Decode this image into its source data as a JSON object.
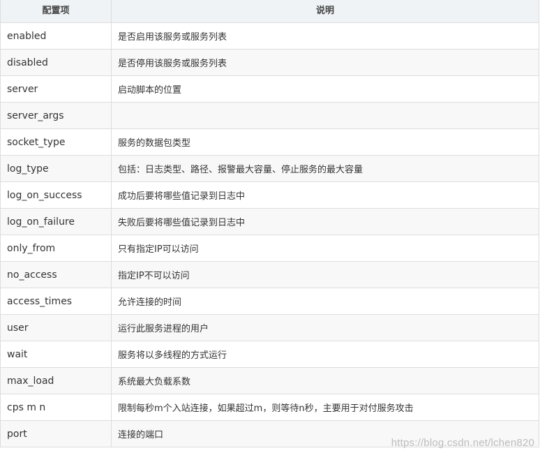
{
  "table": {
    "headers": [
      "配置项",
      "说明"
    ],
    "rows": [
      {
        "key": "enabled",
        "desc": "是否启用该服务或服务列表"
      },
      {
        "key": "disabled",
        "desc": "是否停用该服务或服务列表"
      },
      {
        "key": "server",
        "desc": "启动脚本的位置"
      },
      {
        "key": "server_args",
        "desc": ""
      },
      {
        "key": "socket_type",
        "desc": "服务的数据包类型"
      },
      {
        "key": "log_type",
        "desc": "包括：日志类型、路径、报警最大容量、停止服务的最大容量"
      },
      {
        "key": "log_on_success",
        "desc": "成功后要将哪些值记录到日志中"
      },
      {
        "key": "log_on_failure",
        "desc": "失败后要将哪些值记录到日志中"
      },
      {
        "key": "only_from",
        "desc": "只有指定IP可以访问"
      },
      {
        "key": "no_access",
        "desc": "指定IP不可以访问"
      },
      {
        "key": "access_times",
        "desc": "允许连接的时间"
      },
      {
        "key": "user",
        "desc": "运行此服务进程的用户"
      },
      {
        "key": "wait",
        "desc": "服务将以多线程的方式运行"
      },
      {
        "key": "max_load",
        "desc": "系统最大负载系数"
      },
      {
        "key": "cps m n",
        "desc": "限制每秒m个入站连接，如果超过m，则等待n秒，主要用于对付服务攻击"
      },
      {
        "key": "port",
        "desc": "连接的端口"
      }
    ]
  },
  "watermark": "https://blog.csdn.net/lchen820"
}
